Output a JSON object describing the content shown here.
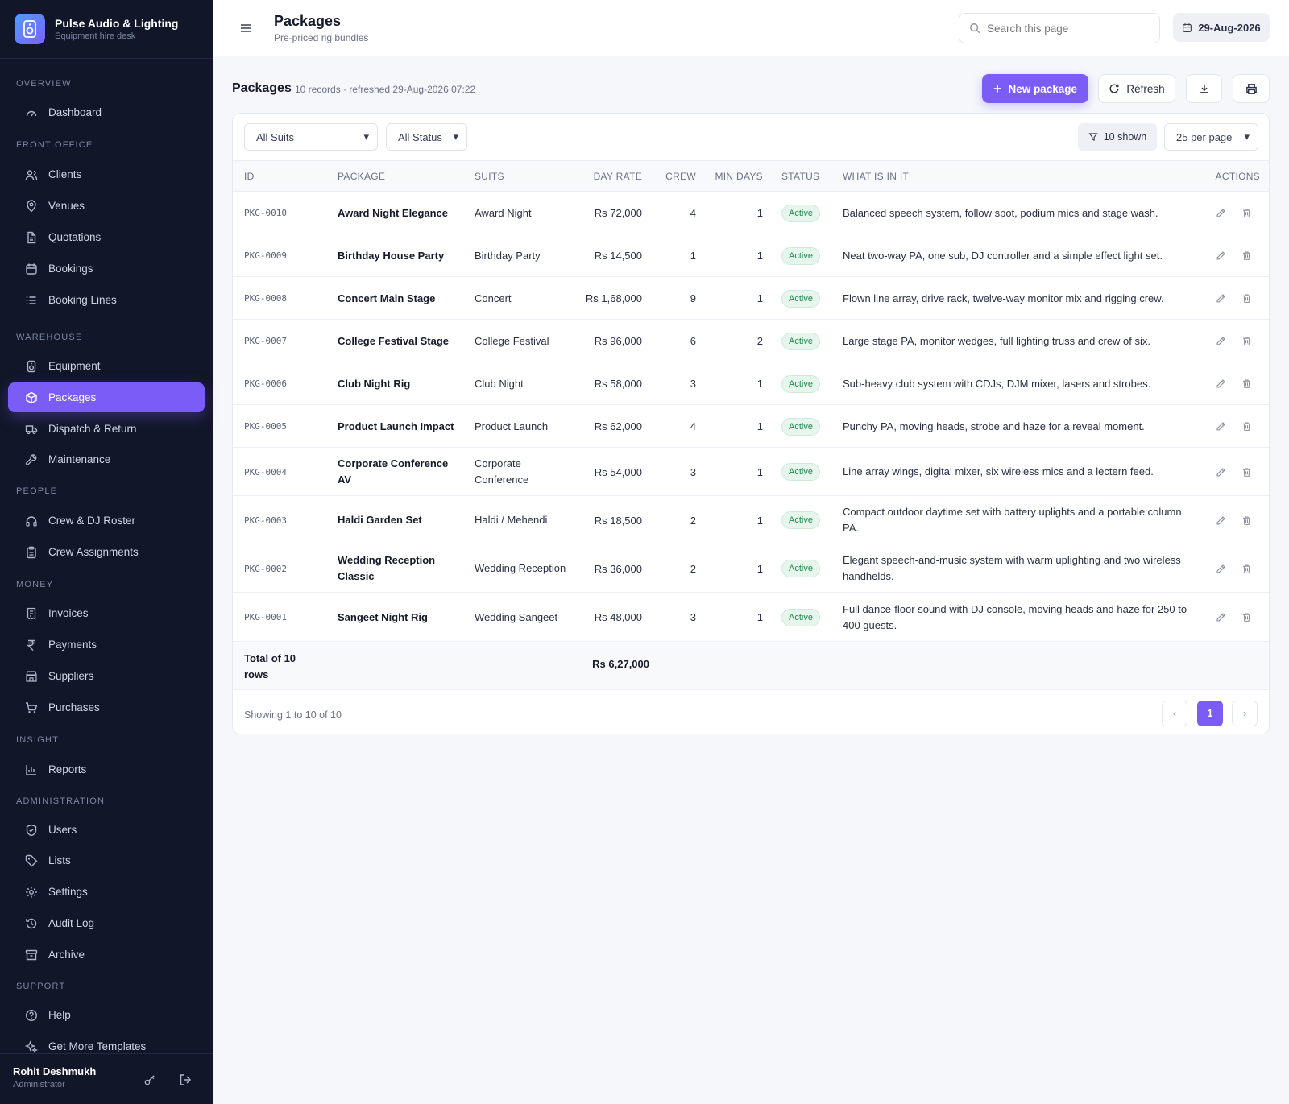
{
  "brand": {
    "title": "Pulse Audio & Lighting",
    "subtitle": "Equipment hire desk"
  },
  "sidebar": {
    "sections": [
      {
        "label": "OVERVIEW",
        "items": [
          {
            "label": "Dashboard",
            "icon": "gauge-icon"
          }
        ]
      },
      {
        "label": "FRONT OFFICE",
        "items": [
          {
            "label": "Clients",
            "icon": "users-icon"
          },
          {
            "label": "Venues",
            "icon": "map-pin-icon"
          },
          {
            "label": "Quotations",
            "icon": "file-icon"
          },
          {
            "label": "Bookings",
            "icon": "calendar-icon"
          },
          {
            "label": "Booking Lines",
            "icon": "list-icon"
          }
        ]
      },
      {
        "label": "WAREHOUSE",
        "items": [
          {
            "label": "Equipment",
            "icon": "speaker-icon"
          },
          {
            "label": "Packages",
            "icon": "box-icon",
            "active": true
          },
          {
            "label": "Dispatch & Return",
            "icon": "truck-icon"
          },
          {
            "label": "Maintenance",
            "icon": "wrench-icon"
          }
        ]
      },
      {
        "label": "PEOPLE",
        "items": [
          {
            "label": "Crew & DJ Roster",
            "icon": "headphones-icon"
          },
          {
            "label": "Crew Assignments",
            "icon": "clipboard-icon"
          }
        ]
      },
      {
        "label": "MONEY",
        "items": [
          {
            "label": "Invoices",
            "icon": "invoice-icon"
          },
          {
            "label": "Payments",
            "icon": "rupee-icon"
          },
          {
            "label": "Suppliers",
            "icon": "store-icon"
          },
          {
            "label": "Purchases",
            "icon": "cart-icon"
          }
        ]
      },
      {
        "label": "INSIGHT",
        "items": [
          {
            "label": "Reports",
            "icon": "bar-chart-icon"
          }
        ]
      },
      {
        "label": "ADMINISTRATION",
        "items": [
          {
            "label": "Users",
            "icon": "shield-icon"
          },
          {
            "label": "Lists",
            "icon": "tag-icon"
          },
          {
            "label": "Settings",
            "icon": "gear-icon"
          },
          {
            "label": "Audit Log",
            "icon": "history-icon"
          },
          {
            "label": "Archive",
            "icon": "archive-icon"
          }
        ]
      },
      {
        "label": "SUPPORT",
        "items": [
          {
            "label": "Help",
            "icon": "help-icon"
          },
          {
            "label": "Get More Templates",
            "icon": "sparkle-icon"
          }
        ]
      }
    ]
  },
  "user": {
    "name": "Rohit Deshmukh",
    "role": "Administrator"
  },
  "topbar": {
    "title": "Packages",
    "subtitle": "Pre-priced rig bundles",
    "search_placeholder": "Search this page",
    "date": "29-Aug-2026"
  },
  "content": {
    "title": "Packages",
    "meta": "10 records · refreshed 29-Aug-2026 07:22",
    "new_label": "New package",
    "refresh_label": "Refresh"
  },
  "filters": {
    "suits": "All Suits",
    "status": "All Status",
    "shown": "10 shown",
    "per_page": "25 per page"
  },
  "table": {
    "headers": {
      "id": "ID",
      "package": "PACKAGE",
      "suits": "SUITS",
      "day_rate": "DAY RATE",
      "crew": "CREW",
      "min_days": "MIN DAYS",
      "status": "STATUS",
      "what": "WHAT IS IN IT",
      "actions": "ACTIONS"
    },
    "rows": [
      {
        "id": "PKG-0010",
        "package": "Award Night Elegance",
        "suits": "Award Night",
        "rate": "Rs 72,000",
        "crew": "4",
        "min_days": "1",
        "status": "Active",
        "what": "Balanced speech system, follow spot, podium mics and stage wash."
      },
      {
        "id": "PKG-0009",
        "package": "Birthday House Party",
        "suits": "Birthday Party",
        "rate": "Rs 14,500",
        "crew": "1",
        "min_days": "1",
        "status": "Active",
        "what": "Neat two-way PA, one sub, DJ controller and a simple effect light set."
      },
      {
        "id": "PKG-0008",
        "package": "Concert Main Stage",
        "suits": "Concert",
        "rate": "Rs 1,68,000",
        "crew": "9",
        "min_days": "1",
        "status": "Active",
        "what": "Flown line array, drive rack, twelve-way monitor mix and rigging crew."
      },
      {
        "id": "PKG-0007",
        "package": "College Festival Stage",
        "suits": "College Festival",
        "rate": "Rs 96,000",
        "crew": "6",
        "min_days": "2",
        "status": "Active",
        "what": "Large stage PA, monitor wedges, full lighting truss and crew of six."
      },
      {
        "id": "PKG-0006",
        "package": "Club Night Rig",
        "suits": "Club Night",
        "rate": "Rs 58,000",
        "crew": "3",
        "min_days": "1",
        "status": "Active",
        "what": "Sub-heavy club system with CDJs, DJM mixer, lasers and strobes."
      },
      {
        "id": "PKG-0005",
        "package": "Product Launch Impact",
        "suits": "Product Launch",
        "rate": "Rs 62,000",
        "crew": "4",
        "min_days": "1",
        "status": "Active",
        "what": "Punchy PA, moving heads, strobe and haze for a reveal moment."
      },
      {
        "id": "PKG-0004",
        "package": "Corporate Conference AV",
        "suits": "Corporate Conference",
        "rate": "Rs 54,000",
        "crew": "3",
        "min_days": "1",
        "status": "Active",
        "what": "Line array wings, digital mixer, six wireless mics and a lectern feed."
      },
      {
        "id": "PKG-0003",
        "package": "Haldi Garden Set",
        "suits": "Haldi / Mehendi",
        "rate": "Rs 18,500",
        "crew": "2",
        "min_days": "1",
        "status": "Active",
        "what": "Compact outdoor daytime set with battery uplights and a portable column PA."
      },
      {
        "id": "PKG-0002",
        "package": "Wedding Reception Classic",
        "suits": "Wedding Reception",
        "rate": "Rs 36,000",
        "crew": "2",
        "min_days": "1",
        "status": "Active",
        "what": "Elegant speech-and-music system with warm uplighting and two wireless handhelds."
      },
      {
        "id": "PKG-0001",
        "package": "Sangeet Night Rig",
        "suits": "Wedding Sangeet",
        "rate": "Rs 48,000",
        "crew": "3",
        "min_days": "1",
        "status": "Active",
        "what": "Full dance-floor sound with DJ console, moving heads and haze for 250 to 400 guests."
      }
    ],
    "footer": {
      "label": "Total of 10 rows",
      "total": "Rs 6,27,000"
    }
  },
  "pager": {
    "info": "Showing 1 to 10 of 10",
    "current": "1"
  },
  "colors": {
    "accent": "#7c5cf6",
    "sidebar_bg": "#111628",
    "active_badge": "#1d8a4c"
  }
}
